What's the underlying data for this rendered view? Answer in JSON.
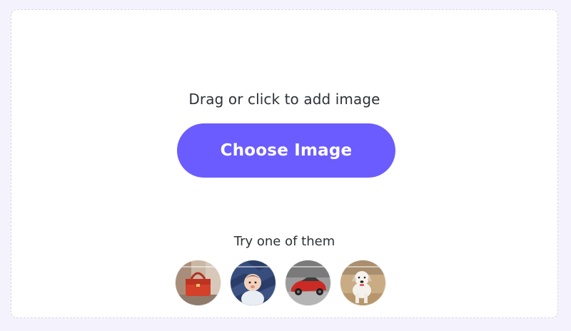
{
  "upload": {
    "hint": "Drag or click to add image",
    "choose_button_label": "Choose Image",
    "accent_color": "#6b5cff"
  },
  "samples": {
    "label": "Try one of them",
    "items": [
      {
        "name": "red-handbag-sample"
      },
      {
        "name": "baby-sample"
      },
      {
        "name": "red-sports-car-sample"
      },
      {
        "name": "white-dog-sample"
      }
    ]
  }
}
